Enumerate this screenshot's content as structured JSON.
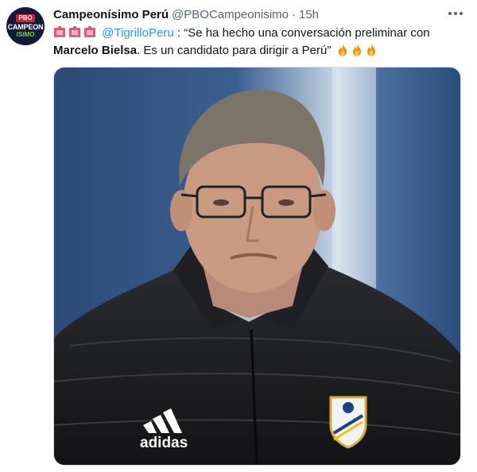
{
  "tweet": {
    "account_name": "Campeonísimo Perú",
    "handle": "@PBOCampeonisimo",
    "separator": "·",
    "time": "15h",
    "avatar": {
      "badge": "PBO",
      "line1": "CAMPEON",
      "line2": "ISIMO"
    },
    "text": {
      "leading_icons": [
        "siren-icon",
        "siren-icon",
        "siren-icon"
      ],
      "mention": "@TigrilloPeru",
      "part1": " : “Se ha hecho una conversación preliminar con ",
      "bold": "Marcelo Bielsa",
      "part2": ". Es un candidato para dirigir a Perú” ",
      "trailing_icons": [
        "fire-icon",
        "fire-icon",
        "fire-icon"
      ]
    },
    "media": {
      "brand_text": "adidas",
      "colors": {
        "background": "#3a5a86",
        "jacket": "#1c1c1e",
        "skin": "#c99a82",
        "hair": "#7c7468"
      }
    }
  },
  "colors": {
    "link": "#1d9bf0",
    "muted": "#536471",
    "text": "#0f1419",
    "border": "#cfd9de"
  }
}
